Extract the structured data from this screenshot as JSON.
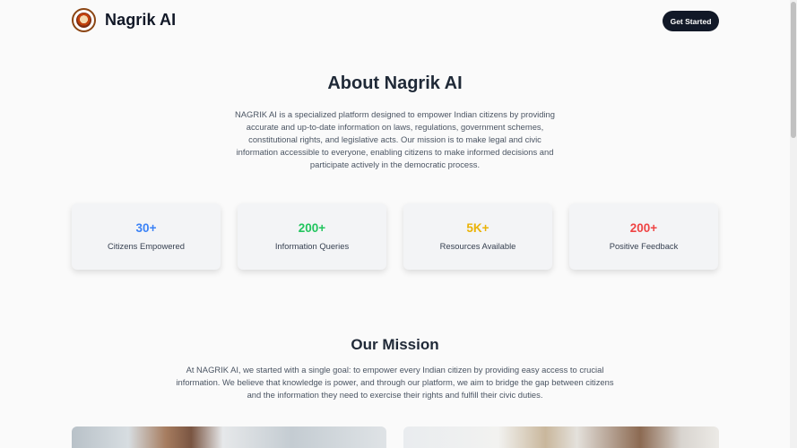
{
  "header": {
    "brand": "Nagrik AI",
    "logo_icon": "emblem-icon",
    "cta_label": "Get Started"
  },
  "about": {
    "title": "About Nagrik AI",
    "lines": [
      "NAGRIK AI is a specialized platform designed to empower Indian citizens by providing",
      "accurate and up-to-date information on laws, regulations, government schemes,",
      "constitutional rights, and legislative acts. Our mission is to make legal and civic",
      "information accessible to everyone, enabling citizens to make informed decisions and",
      "participate actively in the democratic process."
    ]
  },
  "stats": [
    {
      "value": "30+",
      "label": "Citizens Empowered",
      "color": "#3b82f6"
    },
    {
      "value": "200+",
      "label": "Information Queries",
      "color": "#22c55e"
    },
    {
      "value": "5K+",
      "label": "Resources Available",
      "color": "#eab308"
    },
    {
      "value": "200+",
      "label": "Positive Feedback",
      "color": "#ef4444"
    }
  ],
  "mission": {
    "title": "Our Mission",
    "lines": [
      "At NAGRIK AI, we started with a single goal: to empower every Indian citizen by providing easy access to crucial",
      "information. We believe that knowledge is power, and through our platform, we aim to bridge the gap between citizens",
      "and the information they need to exercise their rights and fulfill their civic duties."
    ]
  }
}
